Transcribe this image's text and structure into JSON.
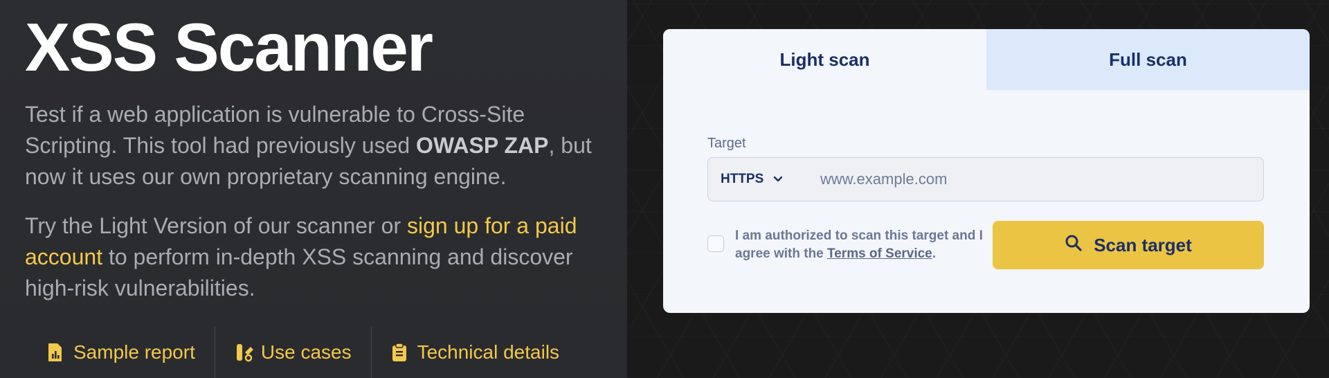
{
  "hero": {
    "title": "XSS Scanner",
    "para1_a": "Test if a web application is vulnerable to Cross-Site Scripting. This tool had previously used ",
    "para1_bold": "OWASP ZAP",
    "para1_b": ", but now it uses our own proprietary scanning engine.",
    "para2_a": "Try the Light Version of our scanner or ",
    "para2_link": "sign up for a paid account",
    "para2_b": " to perform in-depth XSS scanning and discover high-risk vulnerabilities."
  },
  "links": [
    {
      "label": "Sample report",
      "icon": "report-chart-icon"
    },
    {
      "label": "Use cases",
      "icon": "use-cases-icon"
    },
    {
      "label": "Technical details",
      "icon": "clipboard-icon"
    }
  ],
  "scanner": {
    "tabs": [
      {
        "label": "Light scan",
        "active": true
      },
      {
        "label": "Full scan",
        "active": false
      }
    ],
    "target_label": "Target",
    "protocol": "HTTPS",
    "url_placeholder": "www.example.com",
    "url_value": "",
    "consent_a": "I am authorized to scan this target and I agree with the ",
    "consent_link": "Terms of Service",
    "consent_b": ".",
    "scan_button": "Scan target"
  },
  "colors": {
    "accent_yellow": "#f2c94c",
    "button_yellow": "#ebc444",
    "navy": "#1a2f66",
    "left_bg": "#2b2c2f",
    "card_bg": "#f3f6fb",
    "tab_inactive_bg": "#dce9fb"
  }
}
